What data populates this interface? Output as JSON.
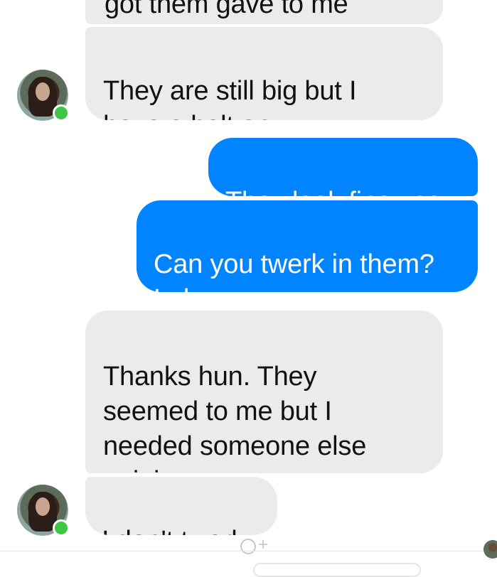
{
  "conversation": {
    "messages": [
      {
        "side": "incoming",
        "text": "got them gave to me"
      },
      {
        "side": "incoming",
        "text": "They are still big but I\nhave a belt on"
      },
      {
        "side": "outgoing",
        "text": "They look fine yes"
      },
      {
        "side": "outgoing",
        "text": "Can you twerk in them?\nLol"
      },
      {
        "side": "incoming",
        "text": "Thanks hun.  They\nseemed to me but I\nneeded someone else\nopinion"
      },
      {
        "side": "incoming",
        "text": "I don't twerk"
      }
    ]
  },
  "icons": {
    "avatar": "contact-avatar",
    "online": "online-status-dot",
    "reaction": "add-reaction-icon",
    "read_receipt": "read-receipt-avatar"
  },
  "colors": {
    "incoming_bubble": "#ebebeb",
    "outgoing_bubble": "#0084ff",
    "online_dot": "#3cc644"
  }
}
